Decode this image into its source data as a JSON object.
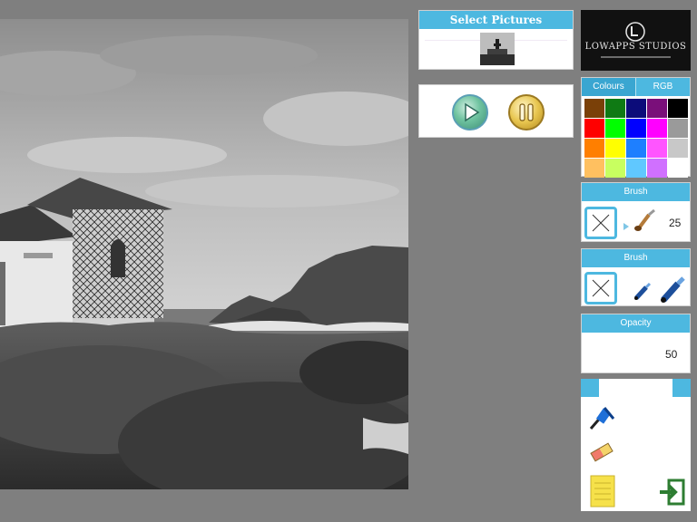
{
  "select_pictures": {
    "title": "Select Pictures"
  },
  "logo": {
    "name": "LOWAPPS STUDIOS"
  },
  "colours_panel": {
    "tabs": [
      "Colours",
      "RGB"
    ],
    "swatches": [
      "#7a4008",
      "#0f7a14",
      "#0c0c7a",
      "#7a0f7a",
      "#000000",
      "#ff0000",
      "#00ff00",
      "#0000ff",
      "#ff00ff",
      "#9a9a9a",
      "#ff7f00",
      "#ffff00",
      "#1e7fff",
      "#ff55ff",
      "#c8c8c8",
      "#ffc060",
      "#c8ff60",
      "#60c8ff",
      "#d070ff",
      "#ffffff"
    ]
  },
  "brush_size_panel": {
    "title": "Brush",
    "value": "25"
  },
  "brush_type_panel": {
    "title": "Brush"
  },
  "opacity_panel": {
    "title": "Opacity",
    "value": "50"
  },
  "colors": {
    "accent": "#4db8e0"
  }
}
